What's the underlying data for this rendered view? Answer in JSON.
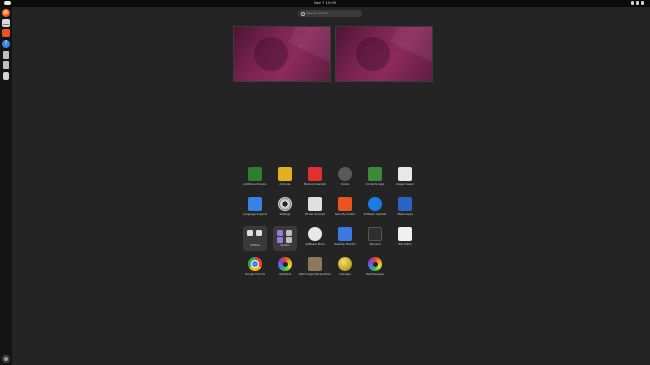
{
  "topbar": {
    "clock": "Nov 7 15:09"
  },
  "dock": [
    {
      "id": "firefox",
      "icon": "firefox-icon"
    },
    {
      "id": "mail",
      "icon": "mail-icon"
    },
    {
      "id": "software",
      "icon": "app-center-icon"
    },
    {
      "id": "help",
      "icon": "help-icon"
    },
    {
      "id": "disk1",
      "icon": "drive-icon"
    },
    {
      "id": "disk2",
      "icon": "drive-icon"
    },
    {
      "id": "trash",
      "icon": "trash-icon"
    }
  ],
  "search": {
    "placeholder": "Type to search"
  },
  "workspaces": [
    {
      "id": "workspace-1"
    },
    {
      "id": "workspace-2"
    }
  ],
  "apps": [
    {
      "name": "Additional Drivers",
      "icon": "chip-icon",
      "color": "#2e7d32"
    },
    {
      "name": "Archives",
      "icon": "archive-icon",
      "color": "#e0b020"
    },
    {
      "name": "Backup Calendar",
      "icon": "calendar-icon",
      "color": "#e03030"
    },
    {
      "name": "Clocks",
      "icon": "clock-icon",
      "color": "#5a5a5a"
    },
    {
      "name": "Contacts Apps",
      "icon": "chip-icon",
      "color": "#3a8a3a"
    },
    {
      "name": "Image Viewer",
      "icon": "magnifier-icon",
      "color": "#e8e8e8"
    },
    {
      "name": "Language Support",
      "icon": "language-icon",
      "color": "#3584e4"
    },
    {
      "name": "Settings",
      "icon": "settings-icon",
      "color": "#cfcfcf"
    },
    {
      "name": "Printer Scanner",
      "icon": "printer-icon",
      "color": "#e0e0e0"
    },
    {
      "name": "Security Center",
      "icon": "shield-icon",
      "color": "#e95420"
    },
    {
      "name": "Software Updater",
      "icon": "app-store-icon",
      "color": "#1c7ce0"
    },
    {
      "name": "Steam Apps",
      "icon": "bars-icon",
      "color": "#2a62c8"
    },
    {
      "name": "Utilities",
      "folder": true
    },
    {
      "name": "System",
      "folder": true
    },
    {
      "name": "Software Store",
      "icon": "store-icon",
      "color": "#e8e8e8"
    },
    {
      "name": "Desktop Monitor",
      "icon": "monitor-icon",
      "color": "#3a7ae0"
    },
    {
      "name": "Terminal",
      "icon": "terminal-icon",
      "color": "#2e2e2e"
    },
    {
      "name": "Text Editor",
      "icon": "notepad-icon",
      "color": "#f0f0f0"
    },
    {
      "name": "Google Chrome",
      "icon": "chrome-icon",
      "color": "#4285f4"
    },
    {
      "name": "darktable",
      "icon": "aperture-icon",
      "color": "#8a4bd0"
    },
    {
      "name": "GNU Image Manipulation",
      "icon": "gimp-icon",
      "color": "#8a7a5a"
    },
    {
      "name": "Inkscape",
      "icon": "inkscape-icon",
      "color": "#d6c22a"
    },
    {
      "name": "RawTherapee",
      "icon": "rawtherapee-icon",
      "color": "#e04040"
    }
  ]
}
